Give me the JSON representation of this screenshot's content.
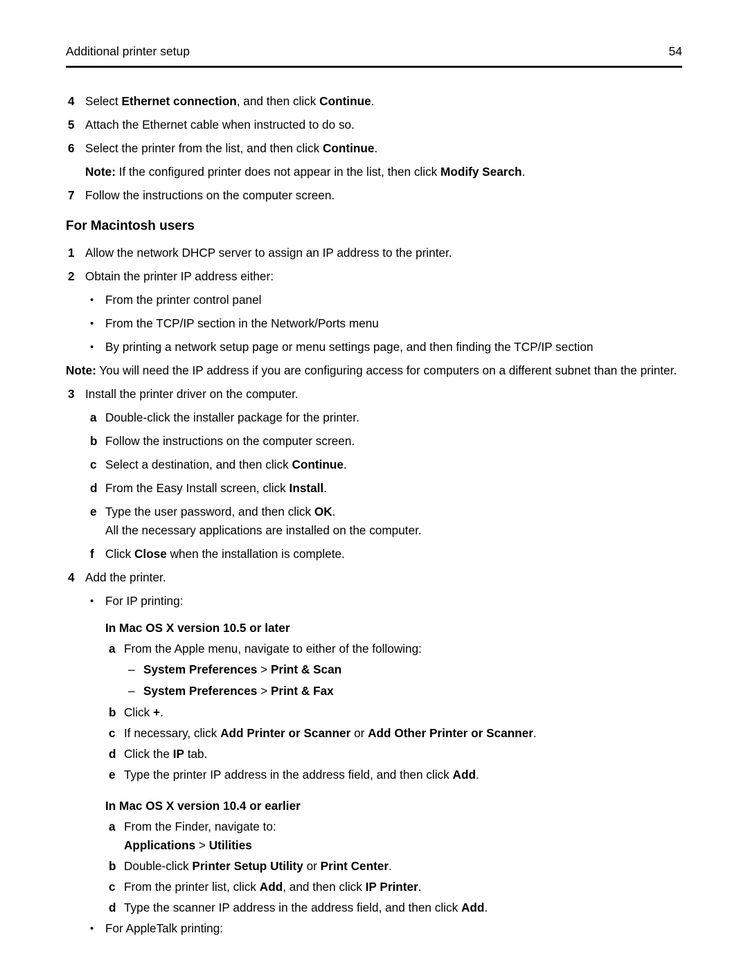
{
  "header": {
    "title": "Additional printer setup",
    "page_number": "54"
  },
  "steps_top": [
    {
      "marker": "4",
      "html": "Select <b>Ethernet connection</b>, and then click <b>Continue</b>."
    },
    {
      "marker": "5",
      "html": "Attach the Ethernet cable when instructed to do so."
    },
    {
      "marker": "6",
      "html": "Select the printer from the list, and then click <b>Continue</b>."
    }
  ],
  "note_modify_search": "<b>Note:</b> If the configured printer does not appear in the list, then click <b>Modify Search</b>.",
  "step_7": {
    "marker": "7",
    "html": "Follow the instructions on the computer screen."
  },
  "macintosh_heading": "For Macintosh users",
  "mac_step_1": {
    "marker": "1",
    "html": "Allow the network DHCP server to assign an IP address to the printer."
  },
  "mac_step_2": {
    "marker": "2",
    "html": "Obtain the printer IP address either:"
  },
  "mac_step_2_bullets": [
    {
      "marker": "•",
      "html": "From the printer control panel"
    },
    {
      "marker": "•",
      "html": "From the TCP/IP section in the Network/Ports menu"
    },
    {
      "marker": "•",
      "html": "By printing a network setup page or menu settings page, and then finding the TCP/IP section"
    }
  ],
  "note_subnet": "<b>Note:</b> You will need the IP address if you are configuring access for computers on a different subnet than the printer.",
  "mac_step_3": {
    "marker": "3",
    "html": "Install the printer driver on the computer."
  },
  "mac_step_3_subs": [
    {
      "marker": "a",
      "html": "Double-click the installer package for the printer."
    },
    {
      "marker": "b",
      "html": "Follow the instructions on the computer screen."
    },
    {
      "marker": "c",
      "html": "Select a destination, and then click <b>Continue</b>."
    },
    {
      "marker": "d",
      "html": "From the Easy Install screen, click <b>Install</b>."
    },
    {
      "marker": "e",
      "html": "Type the user password, and then click <b>OK</b>."
    }
  ],
  "mac_step_3e_cont": "All the necessary applications are installed on the computer.",
  "mac_step_3f": {
    "marker": "f",
    "html": "Click <b>Close</b> when the installation is complete."
  },
  "mac_step_4": {
    "marker": "4",
    "html": "Add the printer."
  },
  "bullet_ip_printing": {
    "marker": "•",
    "html": "For IP printing:"
  },
  "mac105_heading": "In Mac OS X version 10.5 or later",
  "mac105_a": {
    "marker": "a",
    "html": "From the Apple menu, navigate to either of the following:"
  },
  "mac105_a_dashes": [
    {
      "marker": "–",
      "html": "<b>System Preferences</b> <span class=\"reg\">&gt;</span> <b>Print &amp; Scan</b>"
    },
    {
      "marker": "–",
      "html": "<b>System Preferences</b> <span class=\"reg\">&gt;</span> <b>Print &amp; Fax</b>"
    }
  ],
  "mac105_rest": [
    {
      "marker": "b",
      "html": "Click <b>+</b>."
    },
    {
      "marker": "c",
      "html": "If necessary, click <b>Add Printer or Scanner</b> or <b>Add Other Printer or Scanner</b>."
    },
    {
      "marker": "d",
      "html": "Click the <b>IP</b> tab."
    },
    {
      "marker": "e",
      "html": "Type the printer IP address in the address field, and then click <b>Add</b>."
    }
  ],
  "mac104_heading": "In Mac OS X version 10.4 or earlier",
  "mac104_a": {
    "marker": "a",
    "html": "From the Finder, navigate to:"
  },
  "mac104_a_path": "<b>Applications</b> <span class=\"reg\">&gt;</span> <b>Utilities</b>",
  "mac104_rest": [
    {
      "marker": "b",
      "html": "Double-click <b>Printer Setup Utility</b> or <b>Print Center</b>."
    },
    {
      "marker": "c",
      "html": "From the printer list, click <b>Add</b>, and then click <b>IP Printer</b>."
    },
    {
      "marker": "d",
      "html": "Type the scanner IP address in the address field, and then click <b>Add</b>."
    }
  ],
  "bullet_appletalk": {
    "marker": "•",
    "html": "For AppleTalk printing:"
  }
}
